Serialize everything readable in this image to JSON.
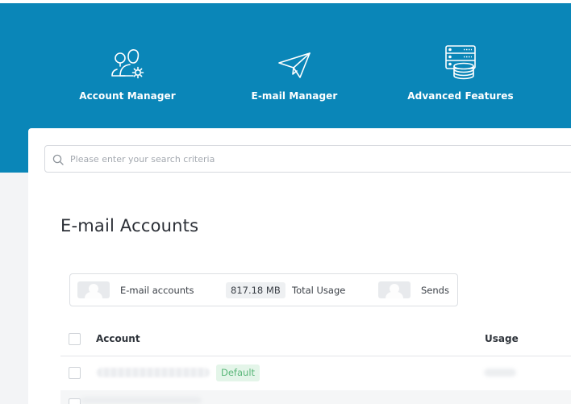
{
  "nav": {
    "items": [
      {
        "label": "Account Manager",
        "icon": "users-gear-icon"
      },
      {
        "label": "E-mail Manager",
        "icon": "paper-plane-icon"
      },
      {
        "label": "Advanced Features",
        "icon": "server-stack-icon"
      }
    ]
  },
  "search": {
    "placeholder": "Please enter your search criteria"
  },
  "page": {
    "title": "E-mail Accounts"
  },
  "stats": {
    "email_accounts_label": "E-mail accounts",
    "total_usage_value": "817.18 MB",
    "total_usage_label": "Total Usage",
    "sends_label": "Sends"
  },
  "table": {
    "columns": [
      "Account",
      "Usage"
    ],
    "rows": [
      {
        "badge": "Default"
      }
    ]
  },
  "colors": {
    "brand": "#0a86b8",
    "badge_bg": "#e4f5e9",
    "badge_text": "#5bb77a"
  }
}
